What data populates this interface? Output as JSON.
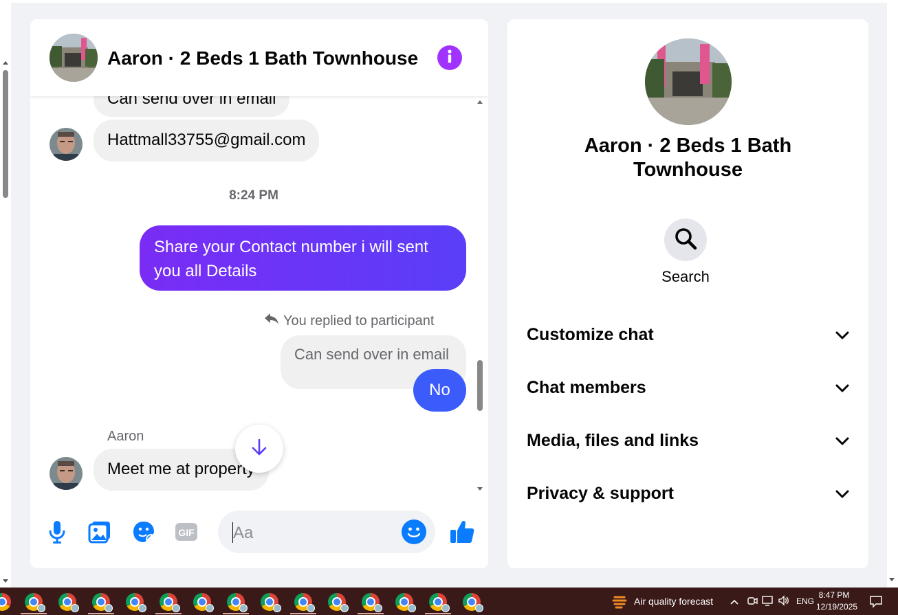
{
  "chat": {
    "title": "Aaron · 2 Beds 1 Bath Townhouse",
    "messages": {
      "cut_text": "Can send over in email",
      "email": "Hattmall33755@gmail.com",
      "timestamp": "8:24 PM",
      "outgoing": "Share your Contact number i will sent you all Details",
      "reply_note": "You replied to participant",
      "reply_quote": "Can send over in email",
      "reply": "No",
      "sender_name": "Aaron",
      "last_incoming": "Meet me at property"
    },
    "composer": {
      "placeholder": "Aa"
    }
  },
  "info": {
    "title": "Aaron · 2 Beds 1 Bath Townhouse",
    "search_label": "Search",
    "sections": [
      "Customize chat",
      "Chat members",
      "Media, files and links",
      "Privacy & support"
    ]
  },
  "taskbar": {
    "weather": "Air quality forecast",
    "language": "ENG",
    "time": "8:47 PM",
    "date": "12/19/2025"
  },
  "colors": {
    "accent": "#a033ff",
    "outgoing_bubble": "#7a2cf5",
    "reply_bubble": "#3b5bfb",
    "icon_blue": "#0a7cff"
  }
}
